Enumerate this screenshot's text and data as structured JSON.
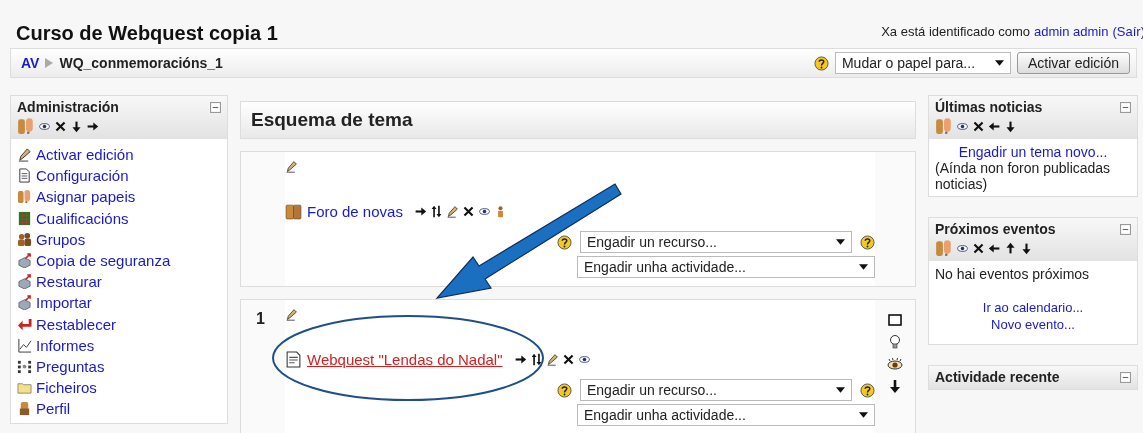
{
  "header": {
    "title": "Curso de Webquest copia 1",
    "login_text": "Xa está identificado como",
    "user": "admin admin",
    "logout": "(Saír)"
  },
  "breadcrumb": [
    "AV",
    "WQ_conmemoracións_1"
  ],
  "role_select": "Mudar o papel para...",
  "edit_button": "Activar edición",
  "admin_block": {
    "title": "Administración",
    "items": [
      "Activar edición",
      "Configuración",
      "Asignar papeis",
      "Cualificacións",
      "Grupos",
      "Copia de seguranza",
      "Restaurar",
      "Importar",
      "Restablecer",
      "Informes",
      "Preguntas",
      "Ficheiros",
      "Perfil"
    ]
  },
  "outline": {
    "title": "Esquema de tema",
    "sections": [
      {
        "side_controls": false,
        "activity": {
          "kind": "forum",
          "name": "Foro de novas",
          "hovered": false
        },
        "resource_select": "Engadir un recurso...",
        "activity_select": "Engadir unha actividade..."
      },
      {
        "number": "1",
        "side_controls": true,
        "activity": {
          "kind": "resource",
          "name": "Webquest \"Lendas do Nadal\"",
          "hovered": true
        },
        "resource_select": "Engadir un recurso...",
        "activity_select": "Engadir unha actividade..."
      }
    ]
  },
  "news_block": {
    "title": "Últimas noticias",
    "link": "Engadir un tema novo...",
    "text": "(Aínda non foron publicadas noticias)"
  },
  "events_block": {
    "title": "Próximos eventos",
    "text": "No hai eventos próximos",
    "links": [
      "Ir ao calendario...",
      "Novo evento..."
    ]
  },
  "recent_block": {
    "title": "Actividade recente"
  }
}
